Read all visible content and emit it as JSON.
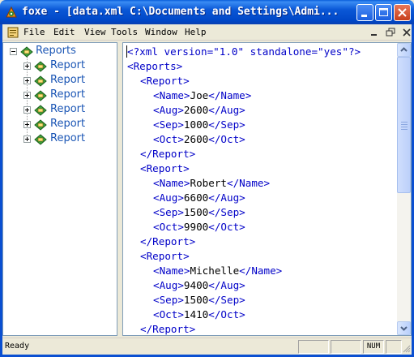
{
  "window": {
    "title": "foxe - [data.xml  C:\\Documents and Settings\\Admi..."
  },
  "menu": {
    "file": "File",
    "edit": "Edit",
    "view": "View",
    "tools": "Tools",
    "window": "Window",
    "help": "Help"
  },
  "tree": {
    "root": "Reports",
    "children": [
      "Report",
      "Report",
      "Report",
      "Report",
      "Report",
      "Report"
    ]
  },
  "editor": {
    "lines": [
      {
        "indent": 0,
        "parts": [
          [
            "decl",
            "<?xml version=\"1.0\" standalone=\"yes\"?>"
          ]
        ]
      },
      {
        "indent": 0,
        "parts": [
          [
            "tag",
            "<Reports>"
          ]
        ]
      },
      {
        "indent": 1,
        "parts": [
          [
            "tag",
            "<Report>"
          ]
        ]
      },
      {
        "indent": 2,
        "parts": [
          [
            "tag",
            "<Name>"
          ],
          [
            "txt",
            "Joe"
          ],
          [
            "tag",
            "</Name>"
          ]
        ]
      },
      {
        "indent": 2,
        "parts": [
          [
            "tag",
            "<Aug>"
          ],
          [
            "txt",
            "2600"
          ],
          [
            "tag",
            "</Aug>"
          ]
        ]
      },
      {
        "indent": 2,
        "parts": [
          [
            "tag",
            "<Sep>"
          ],
          [
            "txt",
            "1000"
          ],
          [
            "tag",
            "</Sep>"
          ]
        ]
      },
      {
        "indent": 2,
        "parts": [
          [
            "tag",
            "<Oct>"
          ],
          [
            "txt",
            "2600"
          ],
          [
            "tag",
            "</Oct>"
          ]
        ]
      },
      {
        "indent": 1,
        "parts": [
          [
            "tag",
            "</Report>"
          ]
        ]
      },
      {
        "indent": 1,
        "parts": [
          [
            "tag",
            "<Report>"
          ]
        ]
      },
      {
        "indent": 2,
        "parts": [
          [
            "tag",
            "<Name>"
          ],
          [
            "txt",
            "Robert"
          ],
          [
            "tag",
            "</Name>"
          ]
        ]
      },
      {
        "indent": 2,
        "parts": [
          [
            "tag",
            "<Aug>"
          ],
          [
            "txt",
            "6600"
          ],
          [
            "tag",
            "</Aug>"
          ]
        ]
      },
      {
        "indent": 2,
        "parts": [
          [
            "tag",
            "<Sep>"
          ],
          [
            "txt",
            "1500"
          ],
          [
            "tag",
            "</Sep>"
          ]
        ]
      },
      {
        "indent": 2,
        "parts": [
          [
            "tag",
            "<Oct>"
          ],
          [
            "txt",
            "9900"
          ],
          [
            "tag",
            "</Oct>"
          ]
        ]
      },
      {
        "indent": 1,
        "parts": [
          [
            "tag",
            "</Report>"
          ]
        ]
      },
      {
        "indent": 1,
        "parts": [
          [
            "tag",
            "<Report>"
          ]
        ]
      },
      {
        "indent": 2,
        "parts": [
          [
            "tag",
            "<Name>"
          ],
          [
            "txt",
            "Michelle"
          ],
          [
            "tag",
            "</Name>"
          ]
        ]
      },
      {
        "indent": 2,
        "parts": [
          [
            "tag",
            "<Aug>"
          ],
          [
            "txt",
            "9400"
          ],
          [
            "tag",
            "</Aug>"
          ]
        ]
      },
      {
        "indent": 2,
        "parts": [
          [
            "tag",
            "<Sep>"
          ],
          [
            "txt",
            "1500"
          ],
          [
            "tag",
            "</Sep>"
          ]
        ]
      },
      {
        "indent": 2,
        "parts": [
          [
            "tag",
            "<Oct>"
          ],
          [
            "txt",
            "1410"
          ],
          [
            "tag",
            "</Oct>"
          ]
        ]
      },
      {
        "indent": 1,
        "parts": [
          [
            "tag",
            "</Report>"
          ]
        ]
      }
    ]
  },
  "status": {
    "text": "Ready",
    "num": "NUM"
  }
}
